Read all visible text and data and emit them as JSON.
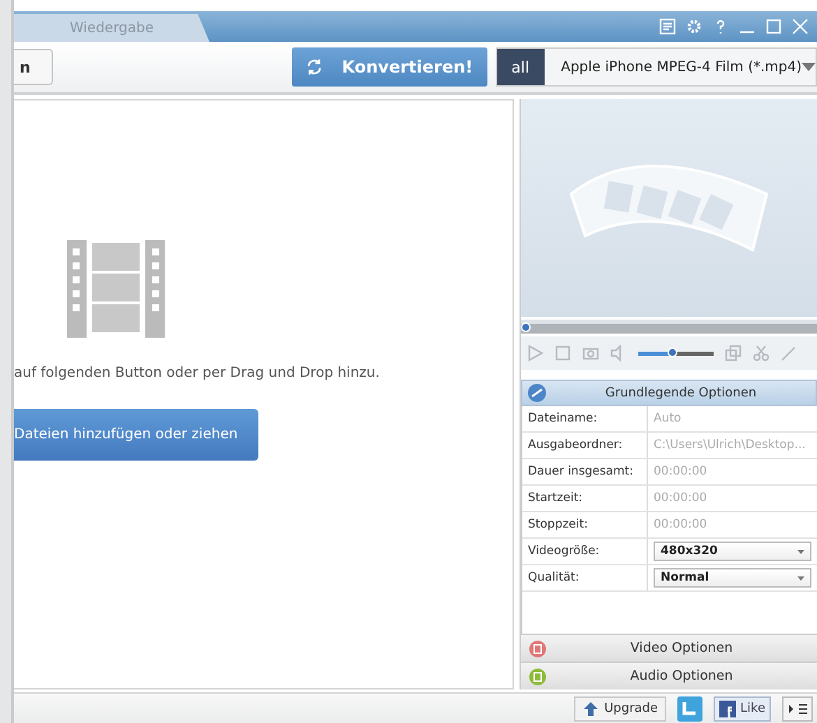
{
  "tabs": [
    {
      "label": "Wiedergabe",
      "selected": false
    }
  ],
  "toolbar": {
    "left_button": "n",
    "convert_button": "Konvertieren!",
    "format_badge": "all",
    "format": "Apple iPhone MPEG-4 Film (*.mp4)"
  },
  "drop_area": {
    "hint": "auf folgenden Button oder per Drag und Drop hinzu.",
    "add_button": "Dateien hinzufügen oder ziehen"
  },
  "player": {
    "seek": {
      "level": 0.0
    },
    "volume": {
      "level": 0.45
    }
  },
  "options": {
    "title": "Grundlegende Optionen",
    "rows": [
      {
        "label": "Dateiname:",
        "value": "Auto",
        "kind": "text"
      },
      {
        "label": "Ausgabeordner:",
        "value": "C:\\Users\\Ulrich\\Desktop...",
        "kind": "text"
      },
      {
        "label": "Dauer insgesamt:",
        "value": "00:00:00",
        "kind": "text"
      },
      {
        "label": "Startzeit:",
        "value": "00:00:00",
        "kind": "text"
      },
      {
        "label": "Stoppzeit:",
        "value": "00:00:00",
        "kind": "text"
      },
      {
        "label": "Videogröße:",
        "value": "480x320",
        "kind": "select"
      },
      {
        "label": "Qualität:",
        "value": "Normal",
        "kind": "select"
      }
    ]
  },
  "sections": [
    {
      "label": "Video Optionen",
      "kind": "video"
    },
    {
      "label": "Audio Optionen",
      "kind": "audio"
    }
  ],
  "status_bar": {
    "upgrade": "Upgrade",
    "like": "Like"
  }
}
